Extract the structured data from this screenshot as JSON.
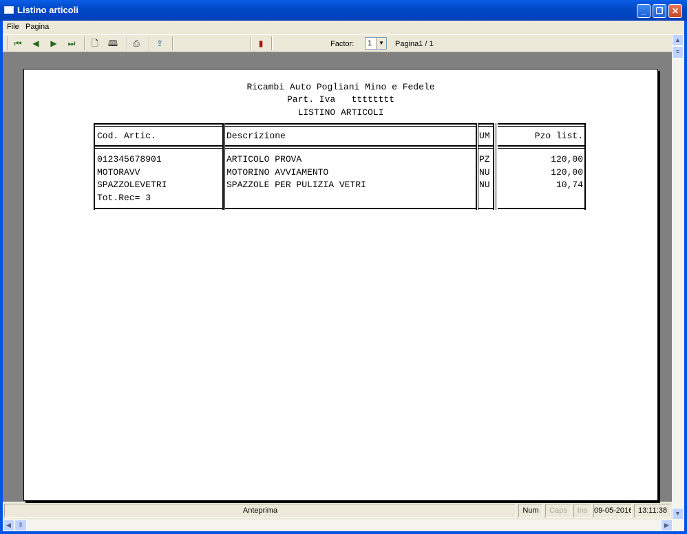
{
  "window": {
    "title": "Listino articoli"
  },
  "menu": {
    "file": "File",
    "pagina": "Pagina"
  },
  "toolbar": {
    "icons": [
      "first-page-icon",
      "previous-page-icon",
      "next-page-icon",
      "last-page-icon",
      "single-page-icon",
      "two-pages-icon",
      "print-icon",
      "export-icon",
      "exit-door-icon"
    ],
    "factor_label": "Factor:",
    "factor_value": "1",
    "page_indicator": "Pagina1 / 1"
  },
  "report": {
    "company": "Ricambi Auto Pogliani Mino e Fedele",
    "vat": "Part. Iva   tttttttt",
    "title": "LISTINO ARTICOLI",
    "columns": {
      "code": "Cod. Artic.",
      "description": "Descrizione",
      "um": "UM",
      "price": "Pzo list."
    },
    "rows": [
      {
        "code": "012345678901",
        "description": "ARTICOLO PROVA",
        "um": "PZ",
        "price": "120,00"
      },
      {
        "code": "MOTORAVV",
        "description": "MOTORINO AVVIAMENTO",
        "um": "NU",
        "price": "120,00"
      },
      {
        "code": "SPAZZOLEVETRI",
        "description": "SPAZZOLE PER PULIZIA VETRI",
        "um": "NU",
        "price": "10,74"
      }
    ],
    "total": "Tot.Rec= 3"
  },
  "status": {
    "mode": "Anteprima",
    "num": "Num",
    "caps": "Caps",
    "ins": "Ins",
    "date": "09-05-2016",
    "time": "13:11:38"
  },
  "colors": {
    "titlebar": "#0054e3",
    "chrome": "#ece9d8",
    "preview_bg": "#808080"
  }
}
